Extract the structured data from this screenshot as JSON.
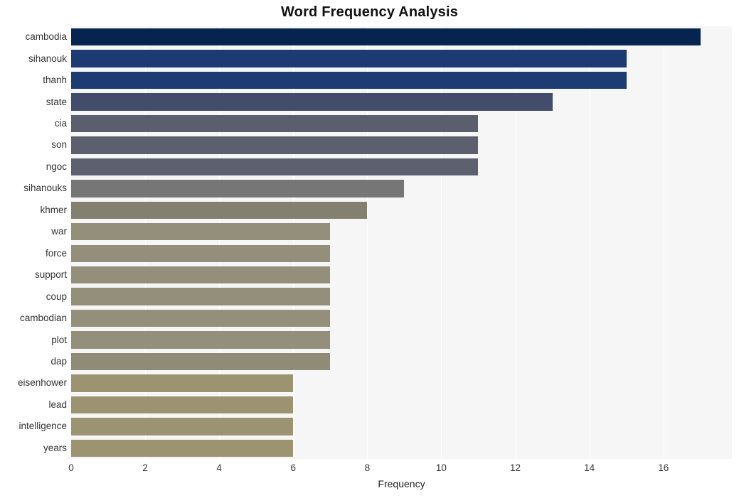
{
  "chart_data": {
    "type": "bar",
    "orientation": "horizontal",
    "title": "Word Frequency Analysis",
    "xlabel": "Frequency",
    "ylabel": "",
    "xlim": [
      0,
      17.85
    ],
    "xticks": [
      0,
      2,
      4,
      6,
      8,
      10,
      12,
      14,
      16
    ],
    "xtick_labels": [
      "0",
      "2",
      "4",
      "6",
      "8",
      "10",
      "12",
      "14",
      "16"
    ],
    "grid": "vertical",
    "legend": "none",
    "categories": [
      "cambodia",
      "sihanouk",
      "thanh",
      "state",
      "cia",
      "son",
      "ngoc",
      "sihanouks",
      "khmer",
      "war",
      "force",
      "support",
      "coup",
      "cambodian",
      "plot",
      "dap",
      "eisenhower",
      "lead",
      "intelligence",
      "years"
    ],
    "values": [
      17,
      15,
      15,
      13,
      11,
      11,
      11,
      9,
      8,
      7,
      7,
      7,
      7,
      7,
      7,
      7,
      6,
      6,
      6,
      6
    ],
    "bar_colors": [
      "#05244f",
      "#1d3a72",
      "#1d3c74",
      "#434d6b",
      "#5a5e6d",
      "#5b5f6e",
      "#5c606f",
      "#767676",
      "#83806f",
      "#948f7a",
      "#948f7a",
      "#948f7a",
      "#948f7a",
      "#948f7a",
      "#948f7a",
      "#908b76",
      "#9c9471",
      "#9c9471",
      "#9c9471",
      "#9c9471"
    ],
    "plot_background": "#f6f6f7",
    "figure_background": "#ffffff",
    "gridline_color": "#ffffff"
  }
}
